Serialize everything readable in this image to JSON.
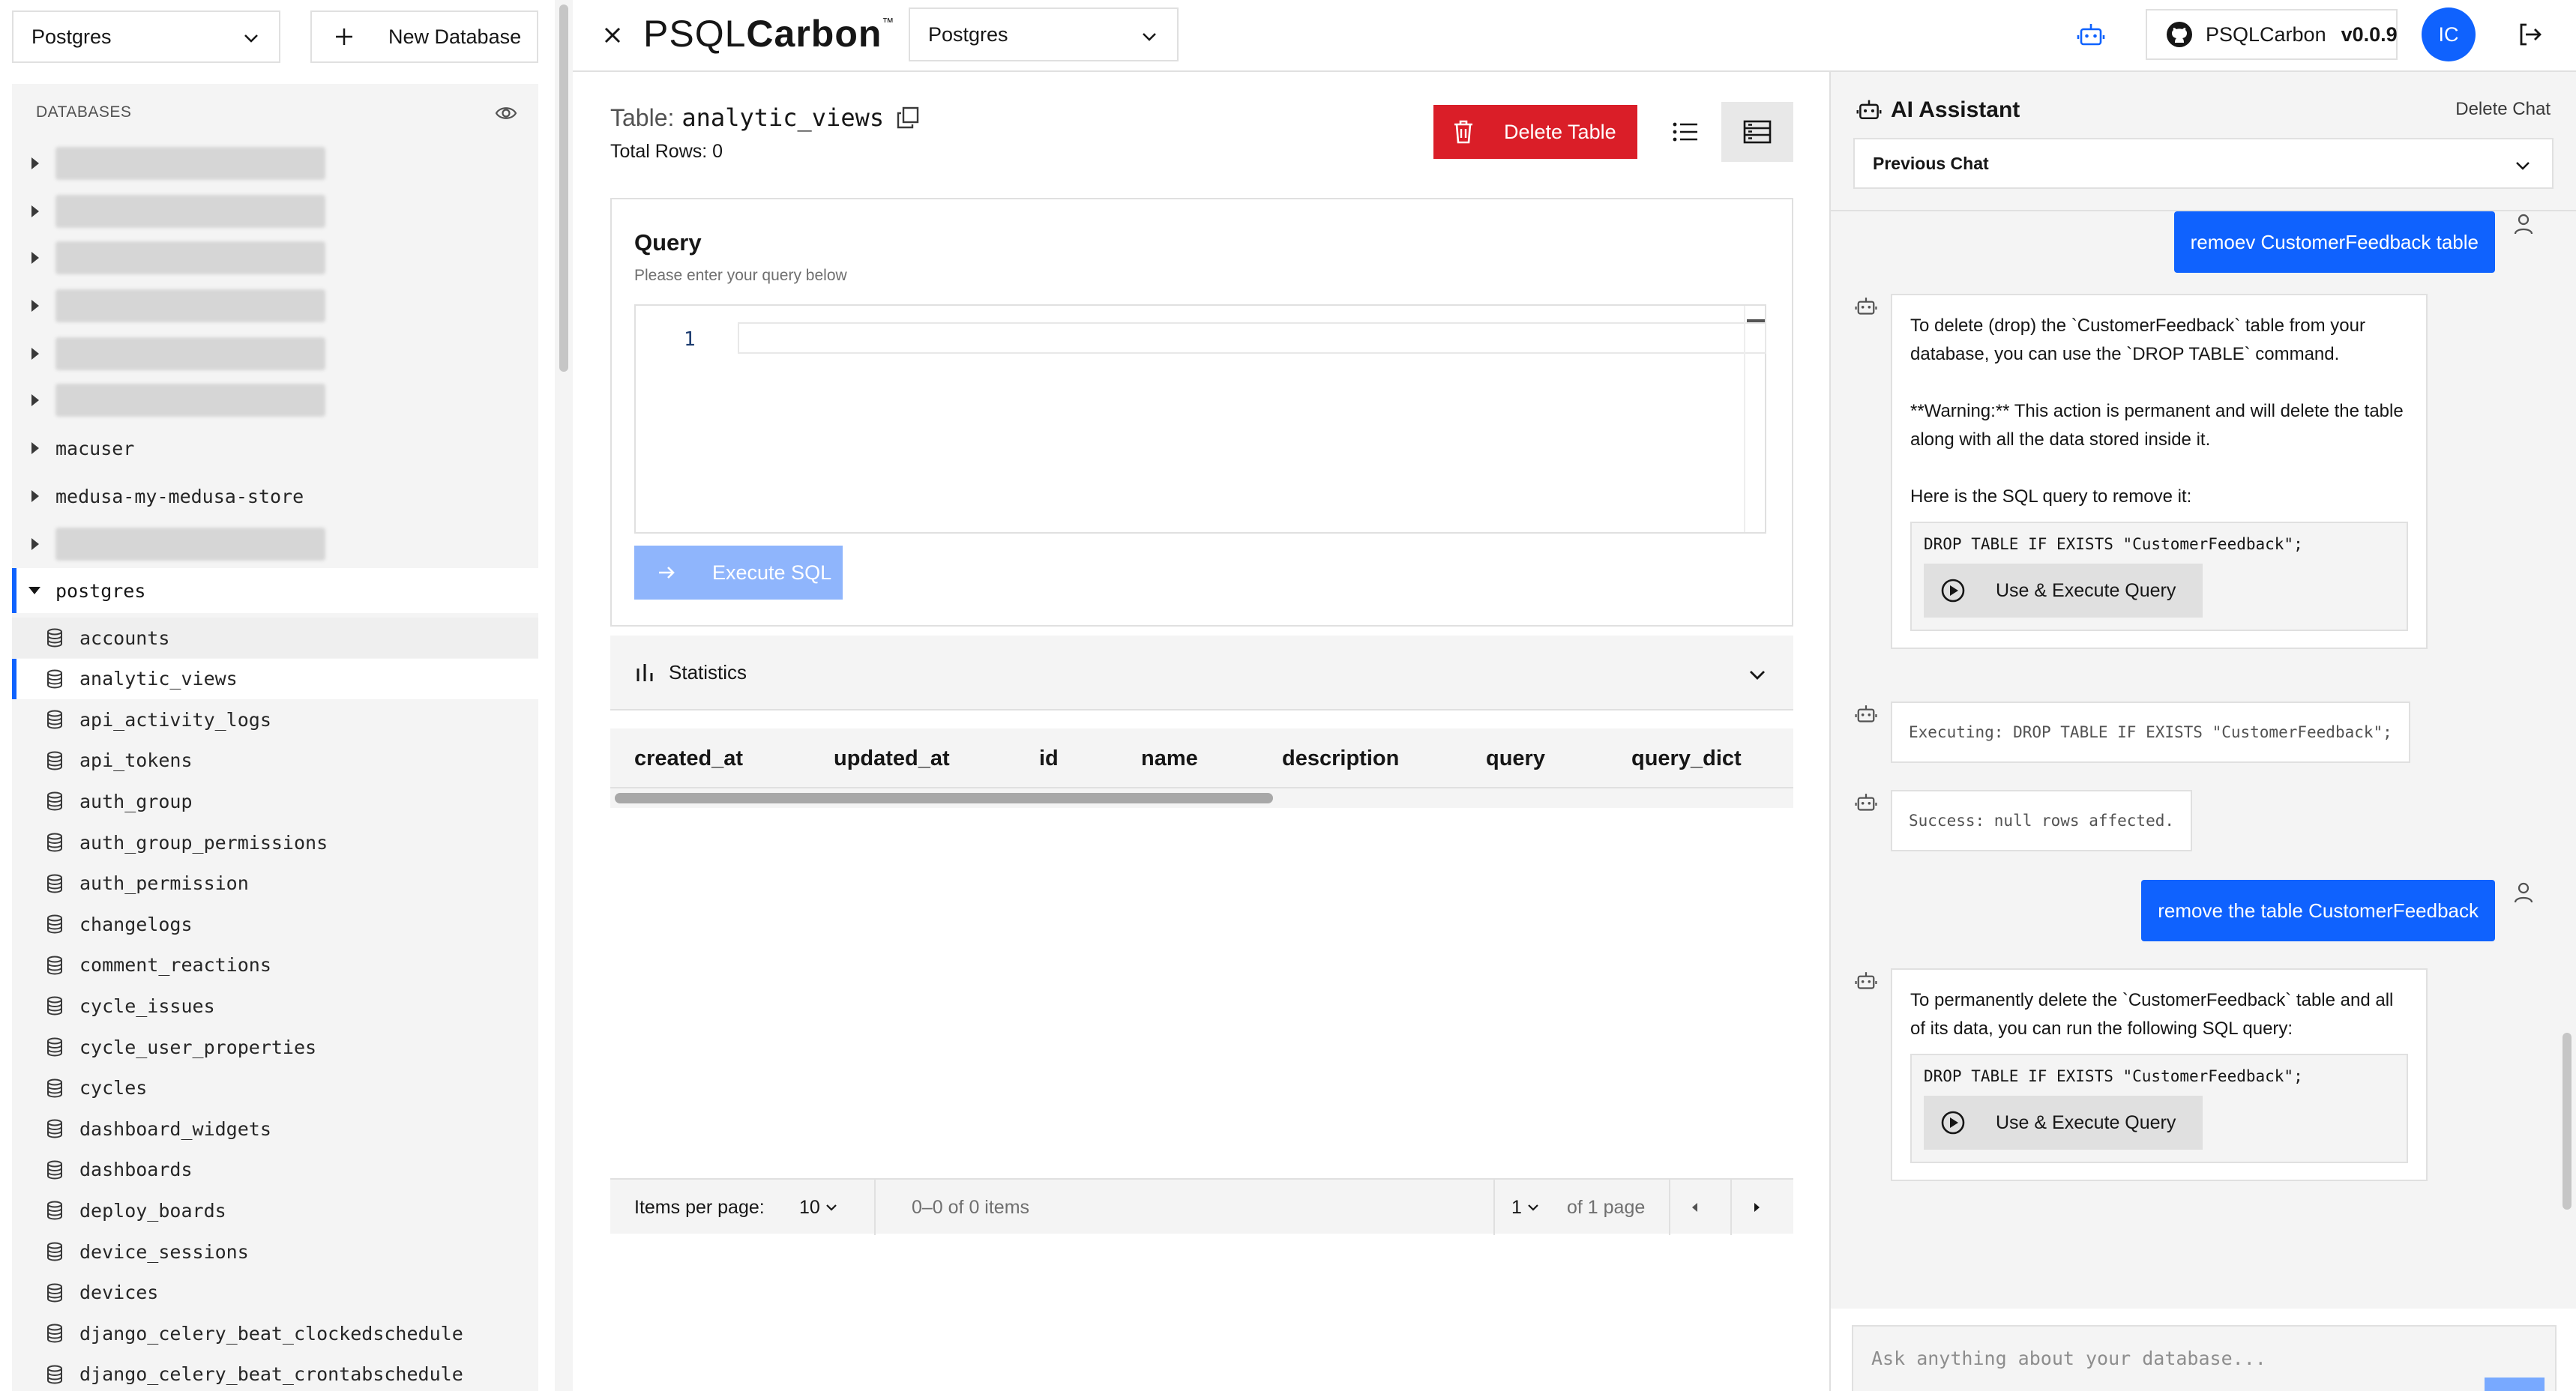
{
  "sidebar": {
    "connection_select": "Postgres",
    "new_database_label": "New Database",
    "section_title": "DATABASES",
    "databases_visible": [
      "macuser",
      "medusa-my-medusa-store"
    ],
    "expanded_database": "postgres",
    "tables": [
      "accounts",
      "analytic_views",
      "api_activity_logs",
      "api_tokens",
      "auth_group",
      "auth_group_permissions",
      "auth_permission",
      "changelogs",
      "comment_reactions",
      "cycle_issues",
      "cycle_user_properties",
      "cycles",
      "dashboard_widgets",
      "dashboards",
      "deploy_boards",
      "device_sessions",
      "devices",
      "django_celery_beat_clockedschedule",
      "django_celery_beat_crontabschedule"
    ],
    "selected_table": "analytic_views"
  },
  "header": {
    "logo_light": "PSQL",
    "logo_bold": "Carbon",
    "logo_tm": "™",
    "db_select": "Postgres",
    "github_label": "PSQLCarbon",
    "version": "v0.0.9",
    "avatar_initials": "IC"
  },
  "main": {
    "table_prefix": "Table:",
    "table_name": "analytic_views",
    "total_rows": "Total Rows: 0",
    "delete_label": "Delete Table",
    "query": {
      "title": "Query",
      "subtitle": "Please enter your query below",
      "line_number": "1",
      "execute_label": "Execute SQL"
    },
    "statistics_label": "Statistics",
    "columns": [
      "created_at",
      "updated_at",
      "id",
      "name",
      "description",
      "query",
      "query_dict"
    ],
    "pager": {
      "items_per_page_label": "Items per page:",
      "items_per_page_value": "10",
      "range_text": "0–0 of 0 items",
      "page_value": "1",
      "page_total": "of 1 page"
    }
  },
  "assistant": {
    "title": "AI Assistant",
    "delete_chat": "Delete Chat",
    "previous_chat": "Previous Chat",
    "messages": {
      "user1": "remoev CustomerFeedback table",
      "bot1_p1": "To delete (drop) the `CustomerFeedback` table from your database, you can use the `DROP TABLE` command.",
      "bot1_p2": "**Warning:** This action is permanent and will delete the table along with all the data stored inside it.",
      "bot1_p3": "Here is the SQL query to remove it:",
      "bot1_code": "DROP TABLE IF EXISTS \"CustomerFeedback\";",
      "use_execute": "Use & Execute Query",
      "status_executing": "Executing: DROP TABLE IF EXISTS \"CustomerFeedback\";",
      "status_success": "Success: null rows affected.",
      "user2": "remove the table CustomerFeedback",
      "bot2_p1": "To permanently delete the `CustomerFeedback` table and all of its data, you can run the following SQL query:",
      "bot2_code": "DROP TABLE IF EXISTS \"CustomerFeedback\";"
    },
    "input_placeholder": "Ask anything about your database..."
  },
  "colors": {
    "primary": "#0f62fe",
    "danger": "#da1e28",
    "execute_disabled": "#8fb5fc",
    "panel_bg": "#f4f4f4"
  }
}
